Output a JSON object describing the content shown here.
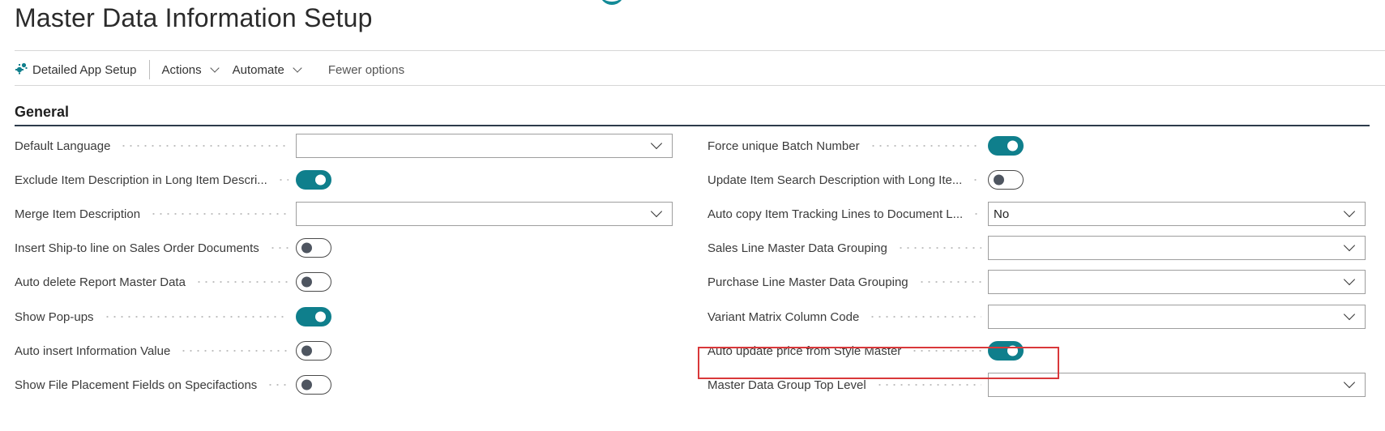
{
  "page": {
    "title": "Master Data Information Setup"
  },
  "toolbar": {
    "detailed_app_setup": "Detailed App Setup",
    "actions": "Actions",
    "automate": "Automate",
    "fewer_options": "Fewer options"
  },
  "section": {
    "title": "General"
  },
  "left_fields": [
    {
      "label": "Default Language",
      "type": "select",
      "value": ""
    },
    {
      "label": "Exclude Item Description in Long Item Descri...",
      "type": "toggle",
      "on": true
    },
    {
      "label": "Merge Item Description",
      "type": "select",
      "value": ""
    },
    {
      "label": "Insert Ship-to line on Sales Order Documents",
      "type": "toggle",
      "on": false
    },
    {
      "label": "Auto delete Report Master Data",
      "type": "toggle",
      "on": false
    },
    {
      "label": "Show Pop-ups",
      "type": "toggle",
      "on": true
    },
    {
      "label": "Auto insert Information Value",
      "type": "toggle",
      "on": false
    },
    {
      "label": "Show File Placement Fields on Specifactions",
      "type": "toggle",
      "on": false
    }
  ],
  "right_fields": [
    {
      "label": "Force unique Batch Number",
      "type": "toggle",
      "on": true
    },
    {
      "label": "Update Item Search Description with Long Ite...",
      "type": "toggle",
      "on": false
    },
    {
      "label": "Auto copy Item Tracking Lines to Document L...",
      "type": "select",
      "value": "No"
    },
    {
      "label": "Sales Line Master Data Grouping",
      "type": "select",
      "value": ""
    },
    {
      "label": "Purchase Line Master Data Grouping",
      "type": "select",
      "value": ""
    },
    {
      "label": "Variant Matrix Column Code",
      "type": "select",
      "value": ""
    },
    {
      "label": "Auto update price from Style Master",
      "type": "toggle",
      "on": true
    },
    {
      "label": "Master Data Group Top Level",
      "type": "select",
      "value": ""
    }
  ],
  "colors": {
    "accent": "#0f7f8c",
    "highlight_border": "#d9383a",
    "section_line": "#2d3b4a"
  },
  "icons": {
    "detailed_app_setup": "puzzle-gear-icon"
  }
}
